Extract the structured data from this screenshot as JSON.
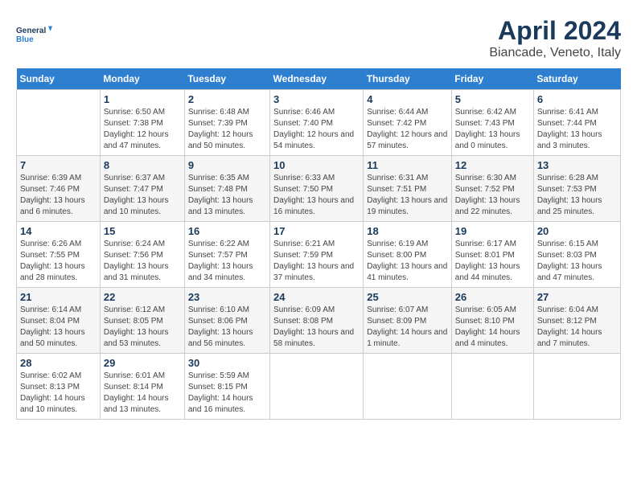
{
  "header": {
    "logo_line1": "General",
    "logo_line2": "Blue",
    "title": "April 2024",
    "subtitle": "Biancade, Veneto, Italy"
  },
  "days_of_week": [
    "Sunday",
    "Monday",
    "Tuesday",
    "Wednesday",
    "Thursday",
    "Friday",
    "Saturday"
  ],
  "weeks": [
    [
      {
        "num": "",
        "sunrise": "",
        "sunset": "",
        "daylight": ""
      },
      {
        "num": "1",
        "sunrise": "Sunrise: 6:50 AM",
        "sunset": "Sunset: 7:38 PM",
        "daylight": "Daylight: 12 hours and 47 minutes."
      },
      {
        "num": "2",
        "sunrise": "Sunrise: 6:48 AM",
        "sunset": "Sunset: 7:39 PM",
        "daylight": "Daylight: 12 hours and 50 minutes."
      },
      {
        "num": "3",
        "sunrise": "Sunrise: 6:46 AM",
        "sunset": "Sunset: 7:40 PM",
        "daylight": "Daylight: 12 hours and 54 minutes."
      },
      {
        "num": "4",
        "sunrise": "Sunrise: 6:44 AM",
        "sunset": "Sunset: 7:42 PM",
        "daylight": "Daylight: 12 hours and 57 minutes."
      },
      {
        "num": "5",
        "sunrise": "Sunrise: 6:42 AM",
        "sunset": "Sunset: 7:43 PM",
        "daylight": "Daylight: 13 hours and 0 minutes."
      },
      {
        "num": "6",
        "sunrise": "Sunrise: 6:41 AM",
        "sunset": "Sunset: 7:44 PM",
        "daylight": "Daylight: 13 hours and 3 minutes."
      }
    ],
    [
      {
        "num": "7",
        "sunrise": "Sunrise: 6:39 AM",
        "sunset": "Sunset: 7:46 PM",
        "daylight": "Daylight: 13 hours and 6 minutes."
      },
      {
        "num": "8",
        "sunrise": "Sunrise: 6:37 AM",
        "sunset": "Sunset: 7:47 PM",
        "daylight": "Daylight: 13 hours and 10 minutes."
      },
      {
        "num": "9",
        "sunrise": "Sunrise: 6:35 AM",
        "sunset": "Sunset: 7:48 PM",
        "daylight": "Daylight: 13 hours and 13 minutes."
      },
      {
        "num": "10",
        "sunrise": "Sunrise: 6:33 AM",
        "sunset": "Sunset: 7:50 PM",
        "daylight": "Daylight: 13 hours and 16 minutes."
      },
      {
        "num": "11",
        "sunrise": "Sunrise: 6:31 AM",
        "sunset": "Sunset: 7:51 PM",
        "daylight": "Daylight: 13 hours and 19 minutes."
      },
      {
        "num": "12",
        "sunrise": "Sunrise: 6:30 AM",
        "sunset": "Sunset: 7:52 PM",
        "daylight": "Daylight: 13 hours and 22 minutes."
      },
      {
        "num": "13",
        "sunrise": "Sunrise: 6:28 AM",
        "sunset": "Sunset: 7:53 PM",
        "daylight": "Daylight: 13 hours and 25 minutes."
      }
    ],
    [
      {
        "num": "14",
        "sunrise": "Sunrise: 6:26 AM",
        "sunset": "Sunset: 7:55 PM",
        "daylight": "Daylight: 13 hours and 28 minutes."
      },
      {
        "num": "15",
        "sunrise": "Sunrise: 6:24 AM",
        "sunset": "Sunset: 7:56 PM",
        "daylight": "Daylight: 13 hours and 31 minutes."
      },
      {
        "num": "16",
        "sunrise": "Sunrise: 6:22 AM",
        "sunset": "Sunset: 7:57 PM",
        "daylight": "Daylight: 13 hours and 34 minutes."
      },
      {
        "num": "17",
        "sunrise": "Sunrise: 6:21 AM",
        "sunset": "Sunset: 7:59 PM",
        "daylight": "Daylight: 13 hours and 37 minutes."
      },
      {
        "num": "18",
        "sunrise": "Sunrise: 6:19 AM",
        "sunset": "Sunset: 8:00 PM",
        "daylight": "Daylight: 13 hours and 41 minutes."
      },
      {
        "num": "19",
        "sunrise": "Sunrise: 6:17 AM",
        "sunset": "Sunset: 8:01 PM",
        "daylight": "Daylight: 13 hours and 44 minutes."
      },
      {
        "num": "20",
        "sunrise": "Sunrise: 6:15 AM",
        "sunset": "Sunset: 8:03 PM",
        "daylight": "Daylight: 13 hours and 47 minutes."
      }
    ],
    [
      {
        "num": "21",
        "sunrise": "Sunrise: 6:14 AM",
        "sunset": "Sunset: 8:04 PM",
        "daylight": "Daylight: 13 hours and 50 minutes."
      },
      {
        "num": "22",
        "sunrise": "Sunrise: 6:12 AM",
        "sunset": "Sunset: 8:05 PM",
        "daylight": "Daylight: 13 hours and 53 minutes."
      },
      {
        "num": "23",
        "sunrise": "Sunrise: 6:10 AM",
        "sunset": "Sunset: 8:06 PM",
        "daylight": "Daylight: 13 hours and 56 minutes."
      },
      {
        "num": "24",
        "sunrise": "Sunrise: 6:09 AM",
        "sunset": "Sunset: 8:08 PM",
        "daylight": "Daylight: 13 hours and 58 minutes."
      },
      {
        "num": "25",
        "sunrise": "Sunrise: 6:07 AM",
        "sunset": "Sunset: 8:09 PM",
        "daylight": "Daylight: 14 hours and 1 minute."
      },
      {
        "num": "26",
        "sunrise": "Sunrise: 6:05 AM",
        "sunset": "Sunset: 8:10 PM",
        "daylight": "Daylight: 14 hours and 4 minutes."
      },
      {
        "num": "27",
        "sunrise": "Sunrise: 6:04 AM",
        "sunset": "Sunset: 8:12 PM",
        "daylight": "Daylight: 14 hours and 7 minutes."
      }
    ],
    [
      {
        "num": "28",
        "sunrise": "Sunrise: 6:02 AM",
        "sunset": "Sunset: 8:13 PM",
        "daylight": "Daylight: 14 hours and 10 minutes."
      },
      {
        "num": "29",
        "sunrise": "Sunrise: 6:01 AM",
        "sunset": "Sunset: 8:14 PM",
        "daylight": "Daylight: 14 hours and 13 minutes."
      },
      {
        "num": "30",
        "sunrise": "Sunrise: 5:59 AM",
        "sunset": "Sunset: 8:15 PM",
        "daylight": "Daylight: 14 hours and 16 minutes."
      },
      {
        "num": "",
        "sunrise": "",
        "sunset": "",
        "daylight": ""
      },
      {
        "num": "",
        "sunrise": "",
        "sunset": "",
        "daylight": ""
      },
      {
        "num": "",
        "sunrise": "",
        "sunset": "",
        "daylight": ""
      },
      {
        "num": "",
        "sunrise": "",
        "sunset": "",
        "daylight": ""
      }
    ]
  ]
}
